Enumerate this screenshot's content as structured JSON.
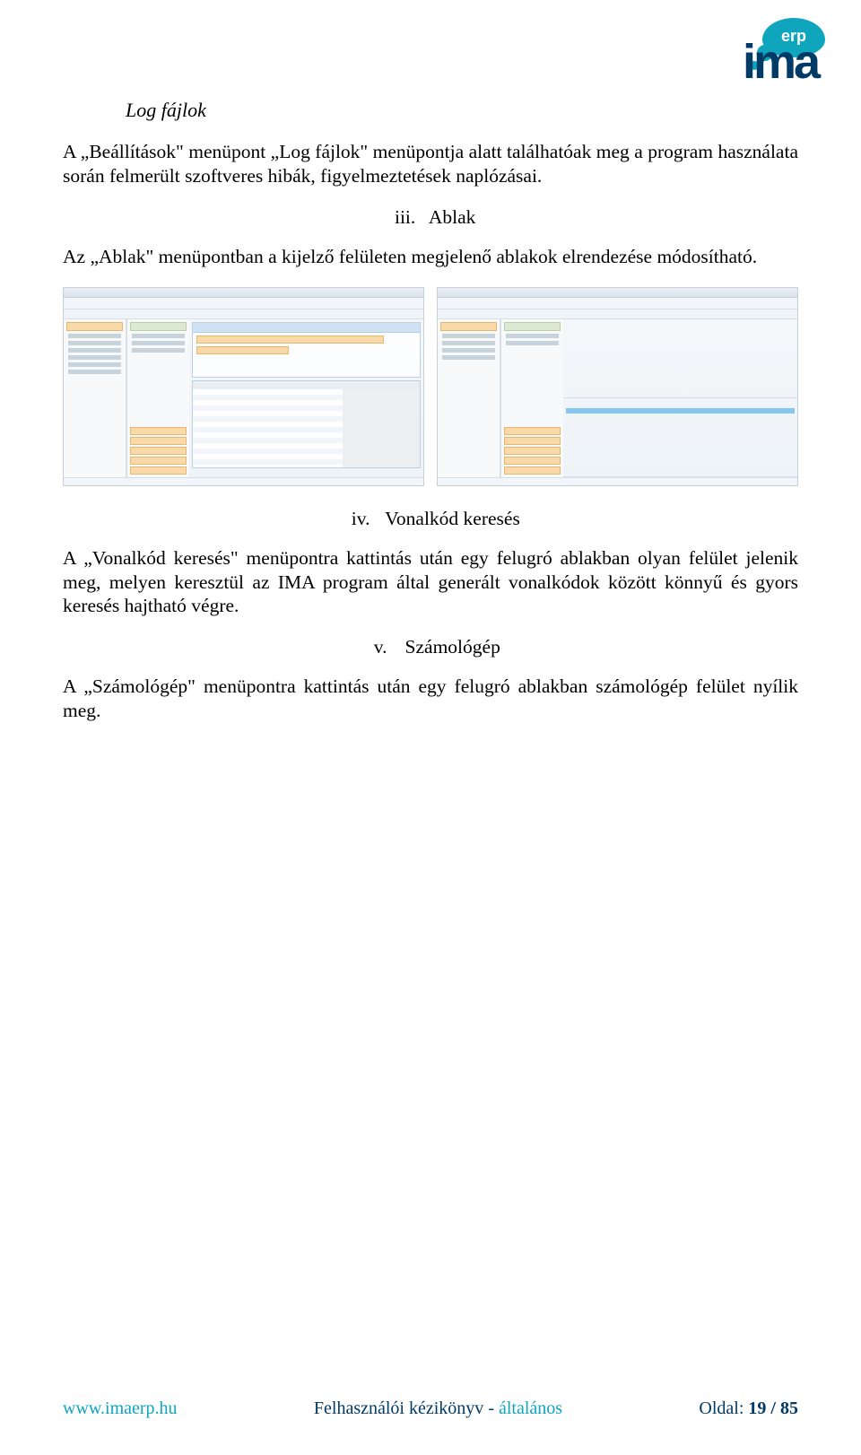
{
  "logo": {
    "erp": "erp",
    "brand": "ima"
  },
  "section_title": "Log fájlok",
  "para1": "A „Beállítások\" menüpont „Log fájlok\" menüpontja alatt találhatóak meg a program használata során felmerült szoftveres hibák, figyelmeztetések naplózásai.",
  "sub_iii": {
    "num": "iii.",
    "label": "Ablak"
  },
  "para2": "Az „Ablak\" menüpontban a kijelző felületen megjelenő ablakok elrendezése módosítható.",
  "sub_iv": {
    "num": "iv.",
    "label": "Vonalkód keresés"
  },
  "para3": "A „Vonalkód keresés\" menüpontra kattintás után egy felugró ablakban olyan felület jelenik meg, melyen keresztül az IMA program által generált vonalkódok között könnyű és gyors keresés hajtható végre.",
  "sub_v": {
    "num": "v.",
    "label": "Számológép"
  },
  "para4": "A „Számológép\" menüpontra kattintás után egy felugró ablakban számológép felület nyílik meg.",
  "footer": {
    "url": "www.imaerp.hu",
    "title_main": "Felhasználói kézikönyv",
    "title_sep": " - ",
    "title_gen": "általános",
    "page_label": "Oldal: ",
    "page_num": "19 / 85"
  }
}
